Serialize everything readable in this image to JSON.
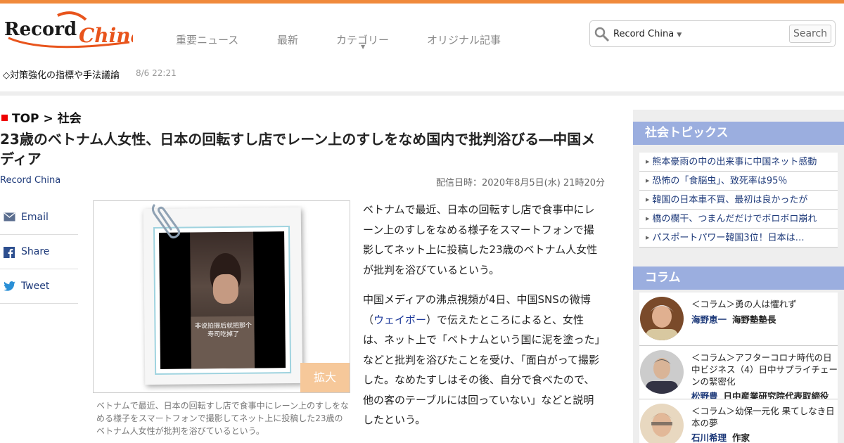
{
  "brand": {
    "logo_text_left": "Record",
    "logo_text_right": "China"
  },
  "nav": {
    "items": [
      "重要ニュース",
      "最新",
      "カテゴリー",
      "オリジナル記事"
    ]
  },
  "search": {
    "scope": "Record China",
    "button": "Search"
  },
  "ticker": {
    "text": "◇対策強化の指標や手法議論",
    "time": "8/6 22:21"
  },
  "breadcrumb": {
    "top": "TOP",
    "sep": ">",
    "section": "社会"
  },
  "article": {
    "title": "23歳のベトナム人女性、日本の回転すし店でレーン上のすしをなめ国内で批判浴びる―中国メディア",
    "source": "Record China",
    "pubdate": "配信日時：2020年8月5日(水) 21時20分",
    "image_overlay": "非说拍摄后就把那个寿司吃掉了",
    "zoom_label": "拡大",
    "caption": "ベトナムで最近、日本の回転すし店で食事中にレーン上のすしをなめる様子をスマートフォンで撮影してネット上に投稿した23歳のベトナム人女性が批判を浴びているという。",
    "p1": "ベトナムで最近、日本の回転すし店で食事中にレーン上のすしをなめる様子をスマートフォンで撮影してネット上に投稿した23歳のベトナム人女性が批判を浴びているという。",
    "p2_before": "中国メディアの沸点視頻が4日、中国SNSの微博（",
    "p2_link": "ウェイボー",
    "p2_after": "）で伝えたところによると、女性は、ネット上で「ベトナムという国に泥を塗った」などと批判を浴びたことを受け、「面白がって撮影した。なめたすしはその後、自分で食べたので、他の客のテーブルには回っていない」などと説明したという。"
  },
  "share": {
    "email": "Email",
    "facebook": "Share",
    "twitter": "Tweet"
  },
  "sidebar": {
    "topics_title": "社会トピックス",
    "topics": [
      "熊本豪雨の中の出来事に中国ネット感動",
      "恐怖の「食脳虫」、致死率は95％",
      "韓国の日本車不買、最初は良かったが",
      "橋の欄干、つまんだだけでボロボロ崩れ",
      "パスポートパワー韓国3位！日本は…"
    ],
    "column_title": "コラム",
    "columns": [
      {
        "title": "＜コラム＞勇の人は懼れず",
        "author": "海野恵一",
        "role": "海野塾塾長"
      },
      {
        "title": "＜コラム＞アフターコロナ時代の日中ビジネス（4）日中サプライチェーンの緊密化",
        "author": "松野豊",
        "role": "日中産業研究院代表取締役"
      },
      {
        "title": "＜コラム＞幼保一元化 果てしなき日本の夢",
        "author": "石川希理",
        "role": "作家"
      }
    ]
  },
  "colors": {
    "accent": "#f08a3c",
    "link": "#1e3a7a",
    "sidebar_head": "#9baedf",
    "breadcrumb_marker": "#e00000"
  }
}
